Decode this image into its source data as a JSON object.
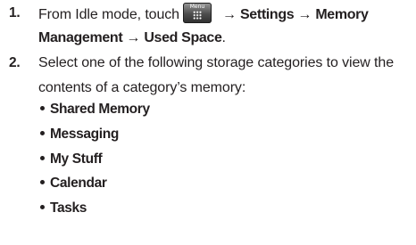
{
  "steps": [
    {
      "number": "1.",
      "line1": {
        "prefix": "From Idle mode, touch",
        "menu_key": {
          "label": "Menu",
          "icon": "menu-grid-icon"
        },
        "arrow1": "→",
        "settings": "Settings",
        "arrow2": "→",
        "memory": "Memory"
      },
      "line2": {
        "management": "Management",
        "arrow": "→",
        "used_space": "Used Space",
        "period": "."
      }
    },
    {
      "number": "2.",
      "line1": "Select one of the following storage categories to view the",
      "line2": "contents of a category’s memory:",
      "bullets": [
        "Shared Memory",
        "Messaging",
        "My Stuff",
        "Calendar",
        "Tasks"
      ]
    }
  ]
}
